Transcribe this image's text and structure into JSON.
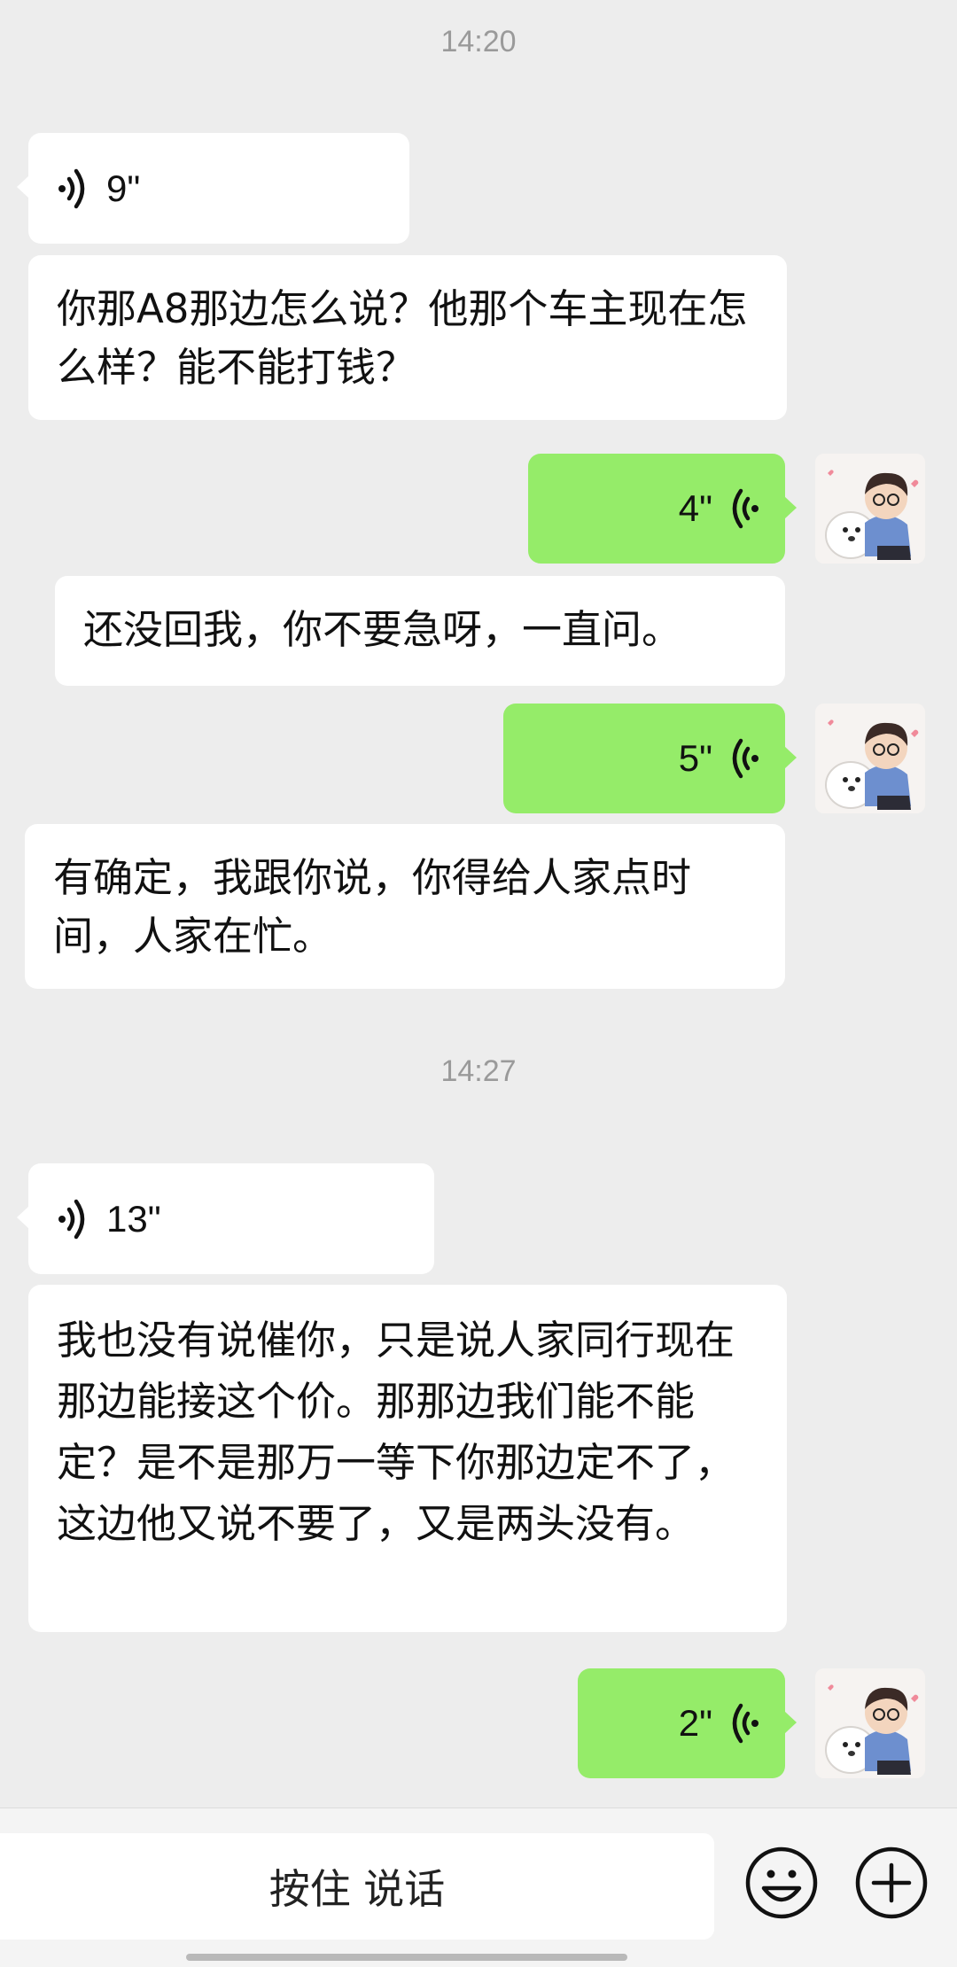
{
  "messages": {
    "time_1": "14:20",
    "time_2": "14:27",
    "voice_1_duration": "9\"",
    "text_1": "你那A8那边怎么说？他那个车主现在怎么样？能不能打钱？",
    "voice_2_duration": "4\"",
    "text_2": "还没回我，你不要急呀，一直问。",
    "voice_3_duration": "5\"",
    "text_3": "有确定，我跟你说，你得给人家点时间，人家在忙。",
    "voice_4_duration": "13\"",
    "text_4": "我也没有说催你，只是说人家同行现在那边能接这个价。那那边我们能不能定？是不是那万一等下你那边定不了，这边他又说不要了，又是两头没有。",
    "voice_5_duration": "2\""
  },
  "input_bar": {
    "hold_to_talk_label": "按住 说话",
    "emoji_icon": "smiley-face-icon",
    "more_icon": "plus-circle-icon"
  },
  "colors": {
    "background": "#ededed",
    "incoming_bubble": "#ffffff",
    "outgoing_bubble": "#95ec69",
    "timestamp": "#9a9a9a"
  }
}
